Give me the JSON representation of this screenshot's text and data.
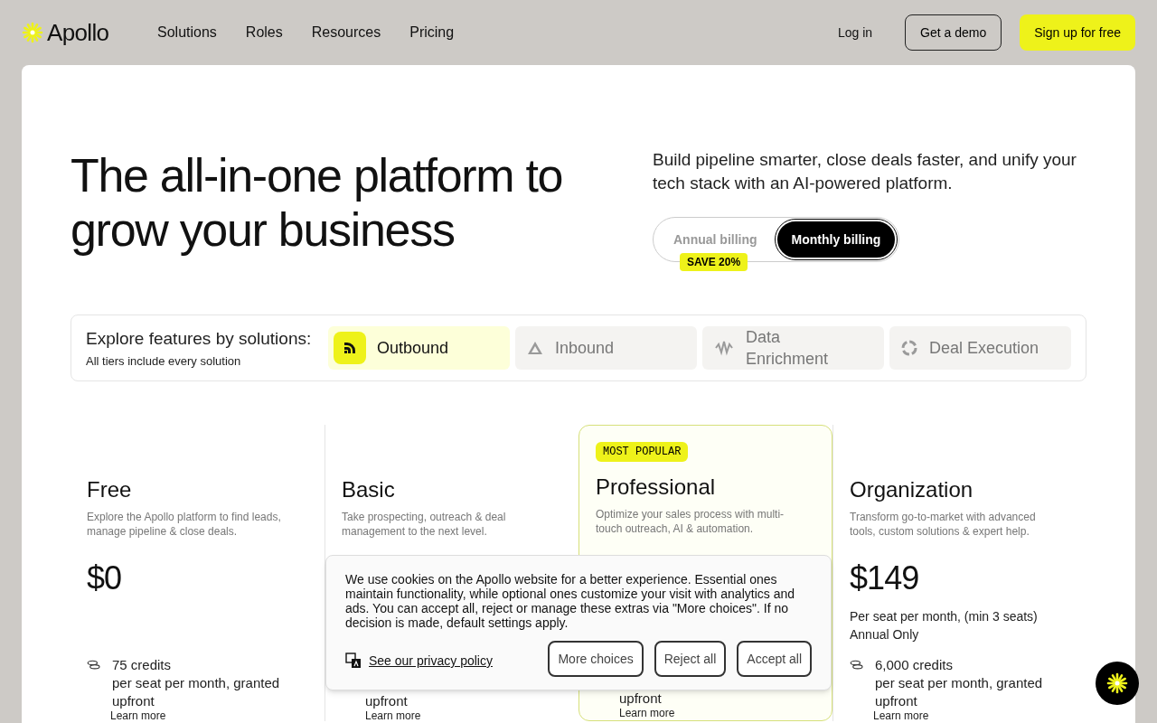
{
  "nav": {
    "brand": "Apollo",
    "links": [
      "Solutions",
      "Roles",
      "Resources",
      "Pricing"
    ],
    "login": "Log in",
    "demo": "Get a demo",
    "signup": "Sign up for free"
  },
  "hero": {
    "title": "The all-in-one platform to grow your business",
    "subtitle": "Build pipeline smarter, close deals faster, and unify your tech stack with an AI-powered platform.",
    "billing": [
      {
        "label": "Annual billing",
        "selected": false
      },
      {
        "label": "Monthly billing",
        "selected": true
      }
    ],
    "save_badge": "SAVE 20%"
  },
  "solutions": {
    "title": "Explore features by solutions:",
    "subtitle": "All tiers include every solution",
    "tabs": [
      {
        "label": "Outbound",
        "kind": "outbound",
        "selected": true
      },
      {
        "label": "Inbound",
        "kind": "inbound",
        "selected": false
      },
      {
        "label": "Data Enrichment",
        "kind": "enrichment",
        "selected": false
      },
      {
        "label": "Deal Execution",
        "kind": "deal",
        "selected": false
      }
    ]
  },
  "plans": [
    {
      "name": "Free",
      "description": "Explore the Apollo platform to find leads, manage pipeline & close deals.",
      "price": "$0",
      "credit_lines": [
        "75 credits",
        "per seat per month, granted",
        "upfront"
      ],
      "learn_more": "Learn more",
      "featured": false
    },
    {
      "name": "Basic",
      "description": "Take prospecting, outreach & deal management to the next level.",
      "credit_lines": [
        "upfront"
      ],
      "learn_more": "Learn more",
      "featured": false
    },
    {
      "name": "Professional",
      "badge": "MOST POPULAR",
      "description": "Optimize your sales process with multi-touch outreach, AI & automation.",
      "credit_lines": [
        "upfront"
      ],
      "learn_more": "Learn more",
      "featured": true
    },
    {
      "name": "Organization",
      "description": "Transform go-to-market with advanced tools, custom solutions & expert help.",
      "price": "$149",
      "price_notes": [
        "Per seat per month, (min 3 seats)",
        "Annual Only"
      ],
      "credit_lines": [
        "6,000 credits",
        "per seat per month, granted",
        "upfront"
      ],
      "learn_more": "Learn more",
      "featured": false
    }
  ],
  "cookie_banner": {
    "text": "We use cookies on the Apollo website for a better experience. Essential ones maintain functionality, while optional ones customize your visit with analytics and ads. You can accept all, reject or manage these extras via \"More choices\". If no decision is made, default settings apply.",
    "privacy_link": "See our privacy policy",
    "buttons": [
      "More choices",
      "Reject all",
      "Accept all"
    ]
  }
}
